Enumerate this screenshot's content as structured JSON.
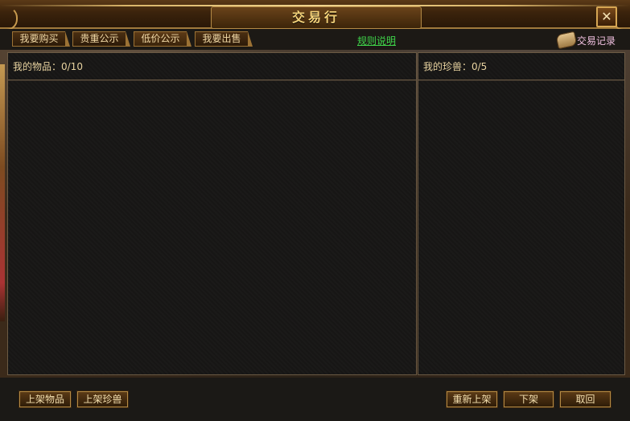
{
  "window": {
    "title": "交易行",
    "close_symbol": "✕"
  },
  "tabs": [
    {
      "label": "我要购买"
    },
    {
      "label": "贵重公示"
    },
    {
      "label": "低价公示"
    },
    {
      "label": "我要出售"
    }
  ],
  "header_links": {
    "rules": "规则说明",
    "trade_log": "交易记录"
  },
  "items_panel": {
    "label": "我的物品：0/10"
  },
  "pets_panel": {
    "label": "我的珍兽：0/5"
  },
  "buttons": {
    "list_item": "上架物品",
    "list_pet": "上架珍兽",
    "relist": "重新上架",
    "delist": "下架",
    "retrieve": "取回"
  },
  "colors": {
    "accent_gold": "#e6cf9a",
    "link_green": "#3fd64a",
    "log_pink": "#f0c0e0"
  }
}
